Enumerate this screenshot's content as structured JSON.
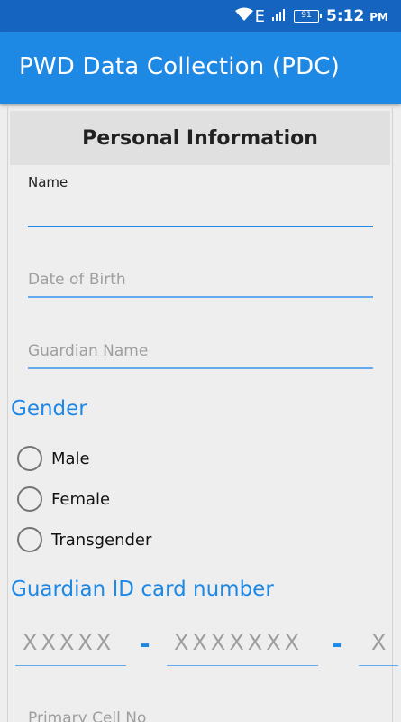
{
  "status_bar": {
    "network_type": "E",
    "battery_level": "91",
    "time": "5:12",
    "time_suffix": "PM"
  },
  "app_bar": {
    "title": "PWD Data Collection (PDC)"
  },
  "section": {
    "title": "Personal Information"
  },
  "form": {
    "name": {
      "label": "Name",
      "value": ""
    },
    "dob": {
      "placeholder": "Date of Birth"
    },
    "guardian_name": {
      "placeholder": "Guardian Name"
    },
    "gender": {
      "heading": "Gender",
      "options": [
        "Male",
        "Female",
        "Transgender"
      ],
      "selected": null
    },
    "guardian_id": {
      "heading": "Guardian ID card number",
      "part1_placeholder": "XXXXX",
      "part2_placeholder": "XXXXXXX",
      "part3_placeholder": "X",
      "separator": "-"
    },
    "primary_cell": {
      "placeholder": "Primary Cell No"
    }
  },
  "colors": {
    "status_bar": "#1565c0",
    "app_bar": "#1e88e5",
    "accent": "#1e88e5",
    "background": "#eeeeee"
  }
}
